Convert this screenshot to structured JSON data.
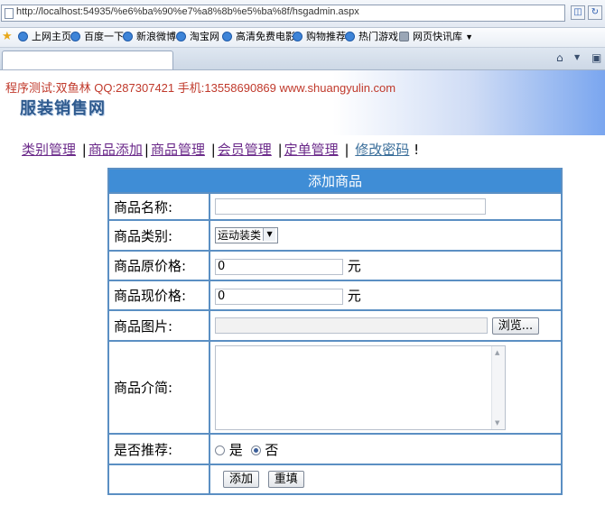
{
  "browser": {
    "url": "http://localhost:54935/%e6%ba%90%e7%a8%8b%e5%ba%8f/hsgadmin.aspx",
    "favorites": [
      {
        "label": "上网主页",
        "icon": "ie-page-icon"
      },
      {
        "label": "百度一下",
        "icon": "ie-page-icon"
      },
      {
        "label": "新浪微博",
        "icon": "ie-page-icon"
      },
      {
        "label": "淘宝网",
        "icon": "ie-page-icon"
      },
      {
        "label": "高清免费电影",
        "icon": "ie-page-icon"
      },
      {
        "label": "购物推荐",
        "icon": "ie-page-icon"
      },
      {
        "label": "热门游戏",
        "icon": "ie-page-icon"
      },
      {
        "label": "网页快讯库",
        "icon": "feed-icon"
      }
    ]
  },
  "banner": {
    "contact": "程序测试:双鱼林 QQ:287307421 手机:13558690869 www.shuangyulin.com",
    "logo_text": "服装销售网"
  },
  "nav": {
    "items": [
      "类别管理",
      "商品添加",
      "商品管理",
      "会员管理",
      "定单管理",
      "修改密码"
    ],
    "sep": "|",
    "end": "!"
  },
  "form": {
    "title": "添加商品",
    "name_label": "商品名称:",
    "name_value": "",
    "category_label": "商品类别:",
    "category_value": "运动装类",
    "orig_price_label": "商品原价格:",
    "orig_price_value": "0",
    "cur_price_label": "商品现价格:",
    "cur_price_value": "0",
    "currency_unit": "元",
    "image_label": "商品图片:",
    "browse_label": "浏览...",
    "intro_label": "商品介简:",
    "recommend_label": "是否推荐:",
    "recommend_yes": "是",
    "recommend_no": "否",
    "recommend_selected": "否",
    "submit_label": "添加",
    "reset_label": "重填"
  },
  "colors": {
    "header_bg": "#3f8dd6",
    "border": "#5b8fc3",
    "contact_text": "#c0392b",
    "nav_link": "#6b2a8a"
  }
}
